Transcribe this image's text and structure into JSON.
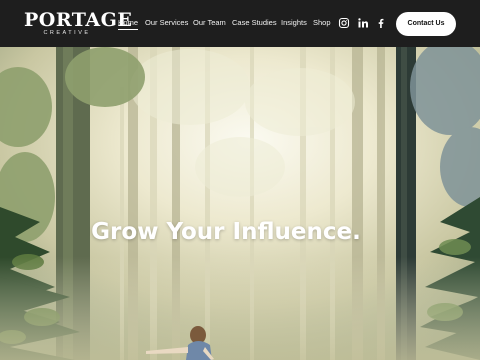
{
  "brand": {
    "name": "PORTAGE",
    "tagline": "CREATIVE"
  },
  "nav": {
    "items": [
      {
        "label": "Home",
        "active": true
      },
      {
        "label": "Our Services",
        "active": false
      },
      {
        "label": "Our Team",
        "active": false
      },
      {
        "label": "Case Studies",
        "active": false
      },
      {
        "label": "Insights",
        "active": false
      },
      {
        "label": "Shop",
        "active": false
      }
    ]
  },
  "social": [
    {
      "icon": "instagram-icon"
    },
    {
      "icon": "linkedin-icon"
    },
    {
      "icon": "facebook-icon"
    }
  ],
  "cta": {
    "label": "Contact Us"
  },
  "hero": {
    "headline": "Grow Your Influence."
  },
  "colors": {
    "header_bg": "#1e1e1e",
    "button_bg": "#ffffff",
    "text": "#ffffff"
  }
}
